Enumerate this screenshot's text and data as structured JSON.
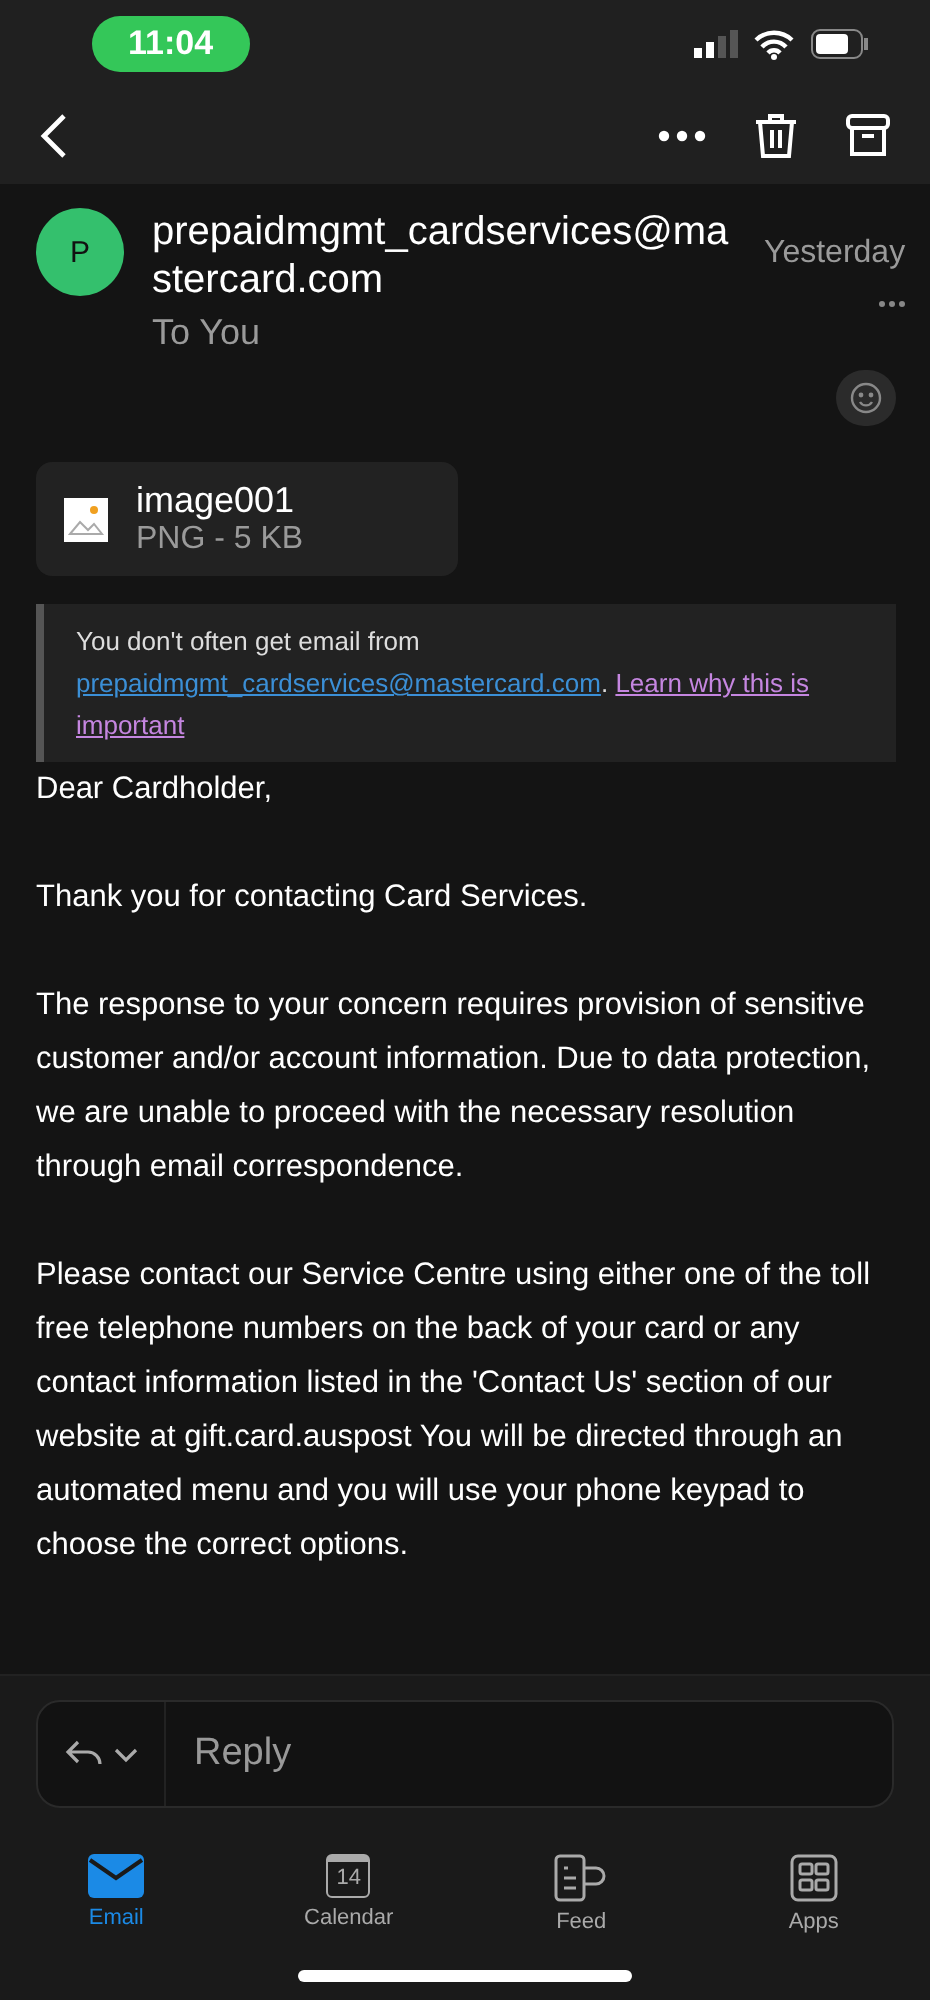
{
  "status_bar": {
    "time": "11:04"
  },
  "sender": {
    "initial": "P",
    "address": "prepaidmgmt_cardservices@mastercard.com",
    "recipient": "To You",
    "date": "Yesterday"
  },
  "attachment": {
    "name": "image001",
    "meta": "PNG - 5 KB"
  },
  "notice": {
    "text": "You don't often get email from",
    "sender_link": "prepaidmgmt_cardservices@mastercard.com",
    "separator": ".",
    "learn_link_1": "Learn why this is",
    "learn_link_2": "important"
  },
  "body": [
    "Dear Cardholder,",
    "Thank you for contacting Card Services.",
    "The response to your concern requires provision of sensitive customer and/or account information. Due to data protection, we are unable to proceed with the necessary resolution through email correspondence.",
    "Please contact our Service Centre using either one of the toll free telephone numbers on the back of your card or any contact information listed in the 'Contact Us' section of our website at gift.card.auspost  You will be directed through an automated menu and you will use your phone keypad to choose the correct options."
  ],
  "reply": {
    "placeholder": "Reply"
  },
  "tabs": [
    {
      "kind": "email",
      "label": "Email",
      "selected": true
    },
    {
      "kind": "calendar",
      "label": "Calendar",
      "icon_text": "14",
      "selected": false
    },
    {
      "kind": "feed",
      "label": "Feed",
      "selected": false
    },
    {
      "kind": "apps",
      "label": "Apps",
      "selected": false
    }
  ]
}
